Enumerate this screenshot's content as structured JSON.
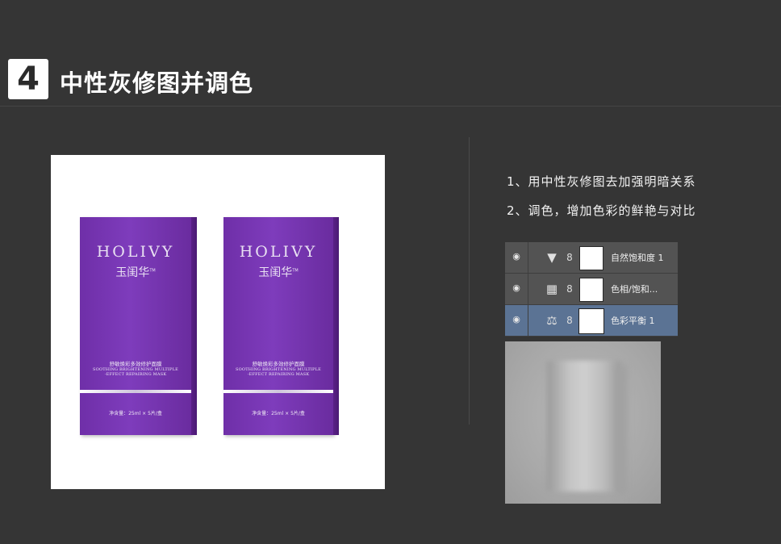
{
  "header": {
    "step_number": "4",
    "title": "中性灰修图并调色"
  },
  "product_image": {
    "boxes": [
      {
        "brand": "HOLIVY",
        "logo_text": "玉闺华",
        "trademark": "TM",
        "name_cn": "舒敏焕彩多效修护面膜",
        "name_en_1": "SOOTHING BRIGHTENING MULTIPLE",
        "name_en_2": "-EFFECT REPAIRING MASK",
        "net_content": "净含量：25ml × 5片/盒"
      },
      {
        "brand": "HOLIVY",
        "logo_text": "玉闺华",
        "trademark": "TM",
        "name_cn": "舒敏焕彩多效修护面膜",
        "name_en_1": "SOOTHING BRIGHTENING MULTIPLE",
        "name_en_2": "-EFFECT REPAIRING MASK",
        "net_content": "净含量：25ml × 5片/盒"
      }
    ]
  },
  "notes": [
    "1、用中性灰修图去加强明暗关系",
    "2、调色，增加色彩的鲜艳与对比"
  ],
  "layers_panel": {
    "selected_color": "#5b7394",
    "layers": [
      {
        "icon": "vibrance-triangle-icon",
        "glyph": "▼",
        "name": "自然饱和度 1",
        "selected": false
      },
      {
        "icon": "hue-saturation-icon",
        "glyph": "▦",
        "name": "色相/饱和...",
        "selected": false
      },
      {
        "icon": "color-balance-icon",
        "glyph": "⚖",
        "name": "色彩平衡 1",
        "selected": true
      }
    ]
  },
  "colors": {
    "background": "#353535",
    "box_purple": "#7e3cbc"
  }
}
